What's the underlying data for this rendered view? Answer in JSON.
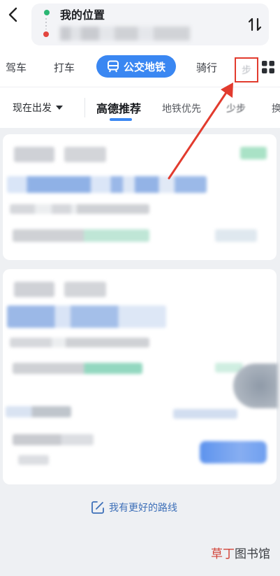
{
  "header": {
    "origin_label": "我的位置",
    "destination_label": ""
  },
  "tabs": {
    "drive": "驾车",
    "taxi": "打车",
    "bus": "公交地铁",
    "ride": "骑行",
    "extra_glyph": "步"
  },
  "filters": {
    "depart": "现在出发",
    "recommend": "高德推荐",
    "subway": "地铁优先",
    "less": "少步",
    "more": "换"
  },
  "footer": {
    "better_route": "我有更好的路线"
  },
  "watermark": {
    "part1": "草丁",
    "part2": "图书馆"
  },
  "colors": {
    "accent_blue": "#3a87f2",
    "annotation_red": "#e23b2e",
    "green": "#2bb673"
  }
}
